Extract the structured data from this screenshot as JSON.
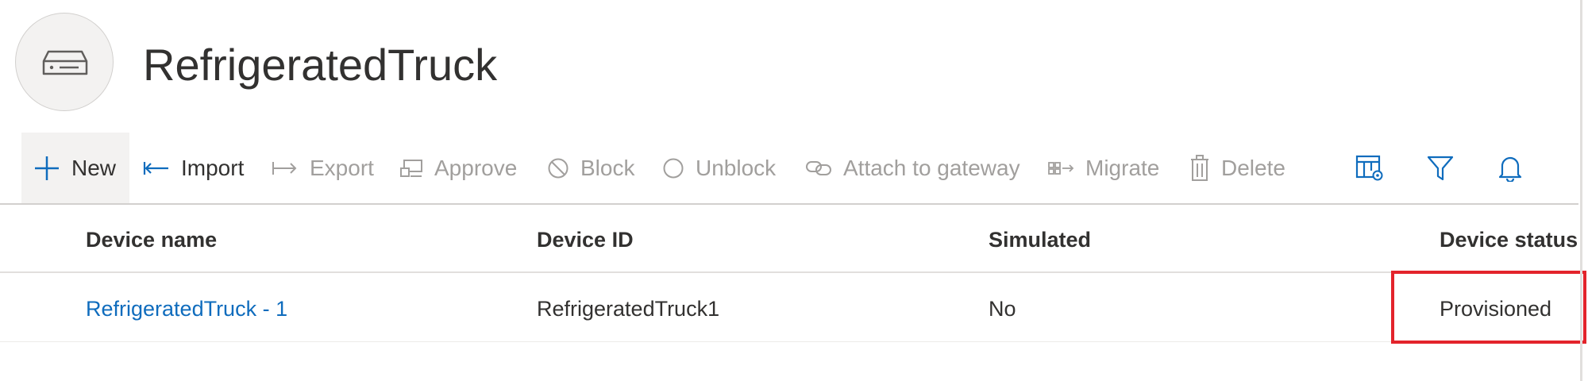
{
  "header": {
    "title": "RefrigeratedTruck",
    "avatar_icon": "device-icon"
  },
  "toolbar": {
    "items": [
      {
        "label": "New",
        "icon": "plus-icon",
        "enabled": true
      },
      {
        "label": "Import",
        "icon": "import-icon",
        "enabled": true
      },
      {
        "label": "Export",
        "icon": "export-icon",
        "enabled": false
      },
      {
        "label": "Approve",
        "icon": "approve-icon",
        "enabled": false
      },
      {
        "label": "Block",
        "icon": "block-icon",
        "enabled": false
      },
      {
        "label": "Unblock",
        "icon": "unblock-icon",
        "enabled": false
      },
      {
        "label": "Attach to gateway",
        "icon": "link-icon",
        "enabled": false
      },
      {
        "label": "Migrate",
        "icon": "migrate-icon",
        "enabled": false
      },
      {
        "label": "Delete",
        "icon": "trash-icon",
        "enabled": false
      }
    ],
    "icon_buttons": [
      "edit-columns-icon",
      "filter-icon",
      "bell-icon"
    ]
  },
  "table": {
    "columns": [
      "Device name",
      "Device ID",
      "Simulated",
      "Device status"
    ],
    "rows": [
      {
        "device_name": "RefrigeratedTruck - 1",
        "device_id": "RefrigeratedTruck1",
        "simulated": "No",
        "device_status": "Provisioned"
      }
    ]
  },
  "colors": {
    "accent": "#0f6cbd",
    "text": "#323130",
    "disabled": "#a19f9d",
    "highlight": "#e3242b"
  }
}
